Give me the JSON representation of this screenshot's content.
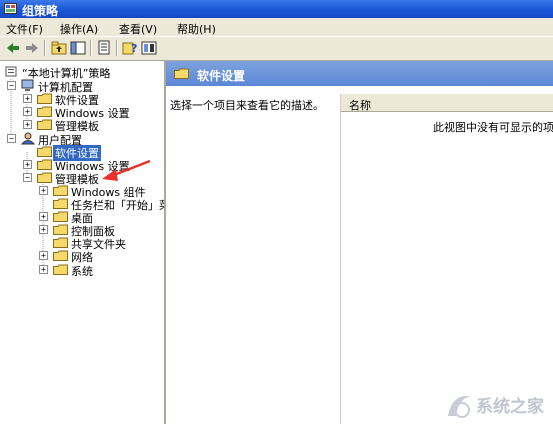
{
  "window": {
    "title": "组策略"
  },
  "menu": [
    "文件(F)",
    "操作(A)",
    "查看(V)",
    "帮助(H)"
  ],
  "toolbar": [
    "back-icon",
    "forward-icon",
    "up-folder-icon",
    "show-hide-tree-icon",
    "export-list-icon",
    "help-icon",
    "properties-icon"
  ],
  "tree": {
    "root": "“本地计算机”策略",
    "computer_config": "计算机配置",
    "cc_software": "软件设置",
    "cc_windows": "Windows 设置",
    "cc_admin": "管理模板",
    "user_config": "用户配置",
    "uc_software": "软件设置",
    "uc_windows": "Windows 设置",
    "uc_admin": "管理模板",
    "win_components": "Windows 组件",
    "taskbar": "任务栏和「开始」菜",
    "desktop": "桌面",
    "control_panel": "控制面板",
    "shared_folders": "共享文件夹",
    "network": "网络",
    "system": "系统"
  },
  "right": {
    "title": "软件设置",
    "description": "选择一个项目来查看它的描述。",
    "column_name": "名称",
    "empty_message": "此视图中没有可显示的项目"
  },
  "watermark": {
    "text": "系统之家"
  },
  "colors": {
    "title_bar": "#1F5BD8",
    "selection": "#316AC5",
    "arrow": "#E8322B",
    "folder": "#F5D96B"
  }
}
